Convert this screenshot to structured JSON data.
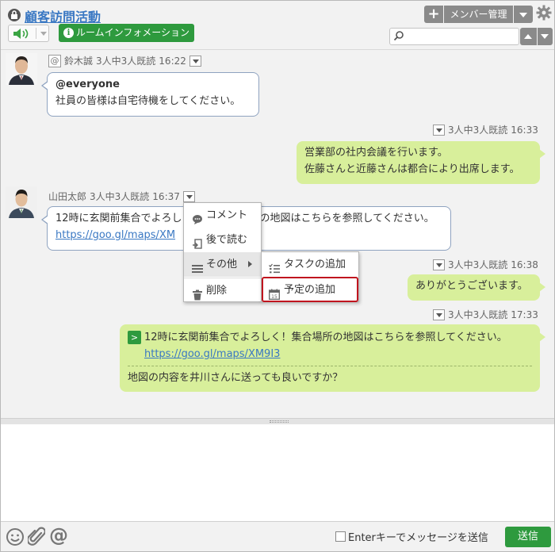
{
  "header": {
    "room_title": "顧客訪問活動",
    "room_info_label": "ルームインフォメーション",
    "member_label": "メンバー管理",
    "add_label": "+",
    "search_placeholder": ""
  },
  "messages": [
    {
      "author": "鈴木誠",
      "read": "3人中3人既読",
      "time": "16:22",
      "line1": "@everyone",
      "line2": "社員の皆様は自宅待機をしてください。"
    },
    {
      "read": "3人中3人既読",
      "time": "16:33",
      "line1": "営業部の社内会議を行います。",
      "line2": "佐藤さんと近藤さんは都合により出席します。"
    },
    {
      "author": "山田太郎",
      "read": "3人中3人既読",
      "time": "16:37",
      "line1": "12時に玄関前集合でよろしく！集合場所の地図はこちらを参照してください。",
      "line1_visible_a": "12時に玄関前集合でよろし",
      "line1_visible_b": "の地図はこちらを参照してください。",
      "link": "https://goo.gl/maps/XM"
    },
    {
      "read": "3人中3人既読",
      "time": "16:38",
      "text": "ありがとうございます。"
    },
    {
      "read": "3人中3人既読",
      "time": "17:33",
      "quote_text": "12時に玄関前集合でよろしく！集合場所の地図はこちらを参照してください。",
      "quote_link": "https://goo.gl/maps/XM9I3",
      "text": "地図の内容を井川さんに送っても良いですか？"
    }
  ],
  "context_menu": {
    "items": [
      "コメント",
      "後で読む",
      "その他",
      "削除"
    ]
  },
  "sub_menu": {
    "items": [
      "タスクの追加",
      "予定の追加"
    ]
  },
  "footer": {
    "enter_label": "Enterキーでメッセージを送信",
    "send_label": "送信"
  },
  "colors": {
    "brand_green": "#2e9a3e",
    "link_blue": "#3a78c3",
    "bubble_green": "#d8ef9b",
    "highlight_red": "#c0151f"
  }
}
